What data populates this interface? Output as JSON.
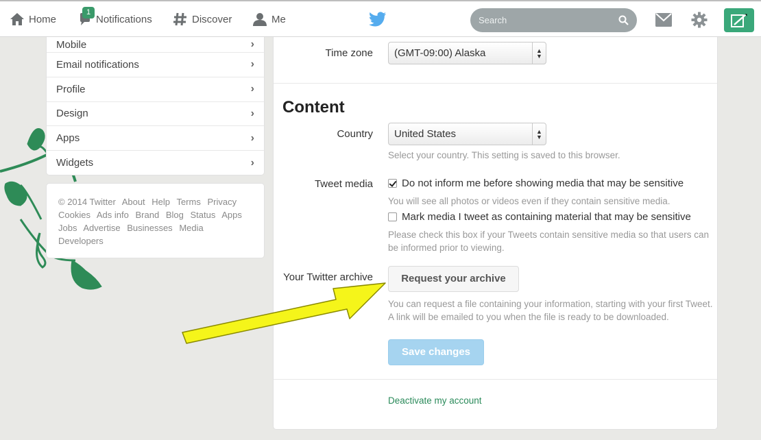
{
  "nav": {
    "home": "Home",
    "notifications": "Notifications",
    "notifications_count": "1",
    "discover": "Discover",
    "me": "Me"
  },
  "search": {
    "placeholder": "Search"
  },
  "colors": {
    "accent": "#3aa87a",
    "link": "#2a8a5a",
    "save_button": "#a6d4f0",
    "arrow": "#f5f51a"
  },
  "sidebar": {
    "items": [
      {
        "label": "Mobile"
      },
      {
        "label": "Email notifications"
      },
      {
        "label": "Profile"
      },
      {
        "label": "Design"
      },
      {
        "label": "Apps"
      },
      {
        "label": "Widgets"
      }
    ],
    "chevron": "›"
  },
  "footer": {
    "copyright": "© 2014 Twitter",
    "links": [
      "About",
      "Help",
      "Terms",
      "Privacy",
      "Cookies",
      "Ads info",
      "Brand",
      "Blog",
      "Status",
      "Apps",
      "Jobs",
      "Advertise",
      "Businesses",
      "Media",
      "Developers"
    ]
  },
  "main": {
    "timezone": {
      "label": "Time zone",
      "value": "(GMT-09:00) Alaska"
    },
    "content_title": "Content",
    "country": {
      "label": "Country",
      "value": "United States",
      "help": "Select your country. This setting is saved to this browser."
    },
    "tweet_media": {
      "label": "Tweet media",
      "option1": {
        "label": "Do not inform me before showing media that may be sensitive",
        "checked": true
      },
      "help1": "You will see all photos or videos even if they contain sensitive media.",
      "option2": {
        "label": "Mark media I tweet as containing material that may be sensitive",
        "checked": false
      },
      "help2_line1": "Please check this box if your Tweets contain sensitive media so that users can",
      "help2_line2": "be informed prior to viewing."
    },
    "archive": {
      "label": "Your Twitter archive",
      "button": "Request your archive",
      "help_line1": "You can request a file containing your information, starting with your first Tweet.",
      "help_line2": "A link will be emailed to you when the file is ready to be downloaded."
    },
    "save_button": "Save changes",
    "deactivate": "Deactivate my account"
  }
}
